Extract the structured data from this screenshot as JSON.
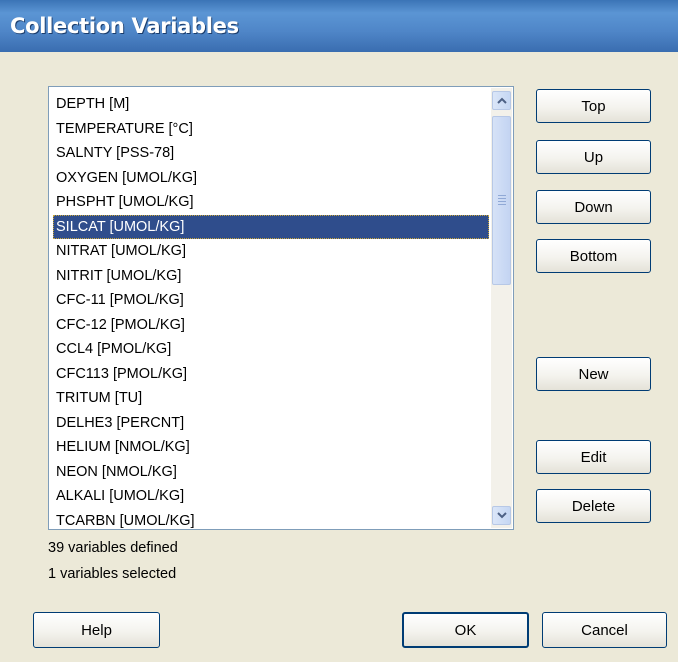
{
  "window": {
    "title": "Collection Variables"
  },
  "variables": [
    "DEPTH [M]",
    "TEMPERATURE [°C]",
    "SALNTY [PSS-78]",
    "OXYGEN [UMOL/KG]",
    "PHSPHT [UMOL/KG]",
    "SILCAT [UMOL/KG]",
    "NITRAT [UMOL/KG]",
    "NITRIT [UMOL/KG]",
    "CFC-11 [PMOL/KG]",
    "CFC-12 [PMOL/KG]",
    "CCL4 [PMOL/KG]",
    "CFC113 [PMOL/KG]",
    "TRITUM [TU]",
    "DELHE3 [PERCNT]",
    "HELIUM [NMOL/KG]",
    "NEON [NMOL/KG]",
    "ALKALI [UMOL/KG]",
    "TCARBN [UMOL/KG]"
  ],
  "selected_index": 5,
  "buttons": {
    "top": "Top",
    "up": "Up",
    "down": "Down",
    "bottom": "Bottom",
    "new": "New",
    "edit": "Edit",
    "delete": "Delete",
    "help": "Help",
    "ok": "OK",
    "cancel": "Cancel"
  },
  "status": {
    "defined": "39 variables defined",
    "selected": "1 variables selected"
  },
  "colors": {
    "titlebar": "#3b74b6",
    "selection": "#2f4d8c",
    "dialog_bg": "#ece9d8"
  },
  "icons": {
    "scroll_up": "chevron-up-icon",
    "scroll_down": "chevron-down-icon"
  }
}
